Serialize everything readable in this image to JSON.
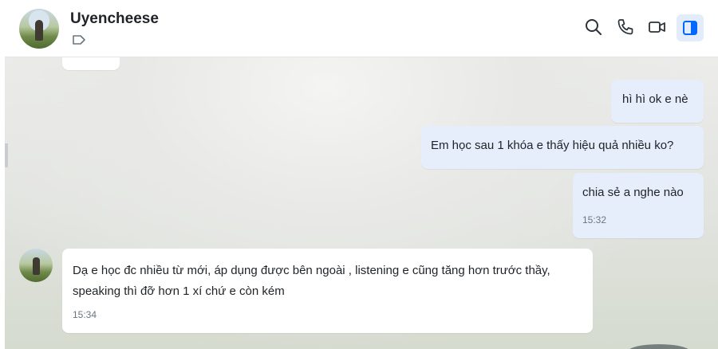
{
  "header": {
    "contact_name": "Uyencheese",
    "icons": [
      "tag-icon",
      "search-icon",
      "phone-icon",
      "video-icon",
      "sidebar-toggle-icon"
    ]
  },
  "messages": [
    {
      "direction": "outgoing",
      "text": "hì hì ok e nè"
    },
    {
      "direction": "outgoing",
      "text": "Em học sau 1 khóa e thấy hiệu quả nhiều ko?"
    },
    {
      "direction": "outgoing",
      "text": "chia sẻ a nghe nào",
      "time": "15:32"
    },
    {
      "direction": "incoming",
      "text": "Dạ e học đc nhiều từ mới, áp dụng được bên ngoài , listening e cũng tăng hơn trước thầy, speaking thì đỡ hơn 1 xí chứ e còn kém",
      "time": "15:34"
    }
  ],
  "colors": {
    "accent": "#0068ff",
    "outgoing_bubble": "#e6eefc",
    "incoming_bubble": "#ffffff",
    "active_button_bg": "#e3ecfb"
  }
}
